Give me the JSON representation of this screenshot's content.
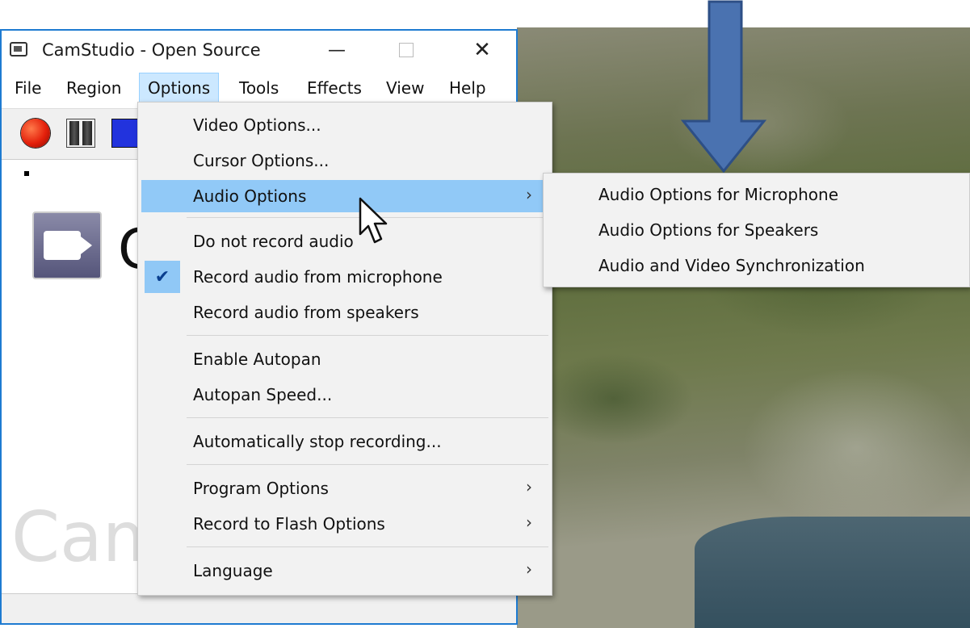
{
  "window": {
    "title": "CamStudio - Open Source",
    "minimize_glyph": "—",
    "close_glyph": "✕",
    "accent_color": "#1e7bd1"
  },
  "menubar": {
    "items": [
      "File",
      "Region",
      "Options",
      "Tools",
      "Effects",
      "View",
      "Help"
    ],
    "active": "Options"
  },
  "toolbar": {
    "buttons": [
      "record-icon",
      "pause-icon",
      "stop-icon"
    ]
  },
  "content": {
    "logo_letter": "C",
    "watermark": "Cam"
  },
  "options_menu": {
    "items": [
      {
        "label": "Video Options..."
      },
      {
        "label": "Cursor Options..."
      },
      {
        "label": "Audio Options",
        "submenu": true,
        "highlighted": true
      },
      {
        "label": "Do not record audio"
      },
      {
        "label": "Record audio from microphone",
        "checked": true
      },
      {
        "label": "Record audio from speakers"
      },
      {
        "label": "Enable Autopan"
      },
      {
        "label": "Autopan Speed..."
      },
      {
        "label": "Automatically stop recording..."
      },
      {
        "label": "Program Options",
        "submenu": true
      },
      {
        "label": "Record to Flash Options",
        "submenu": true
      },
      {
        "label": "Language",
        "submenu": true
      }
    ],
    "submenu_glyph": "›",
    "check_glyph": "✔",
    "highlight_color": "#91c9f7"
  },
  "audio_submenu": {
    "items": [
      "Audio Options for Microphone",
      "Audio Options for Speakers",
      "Audio and Video Synchronization"
    ]
  },
  "annotation": {
    "arrow_color": "#4a72b0"
  }
}
